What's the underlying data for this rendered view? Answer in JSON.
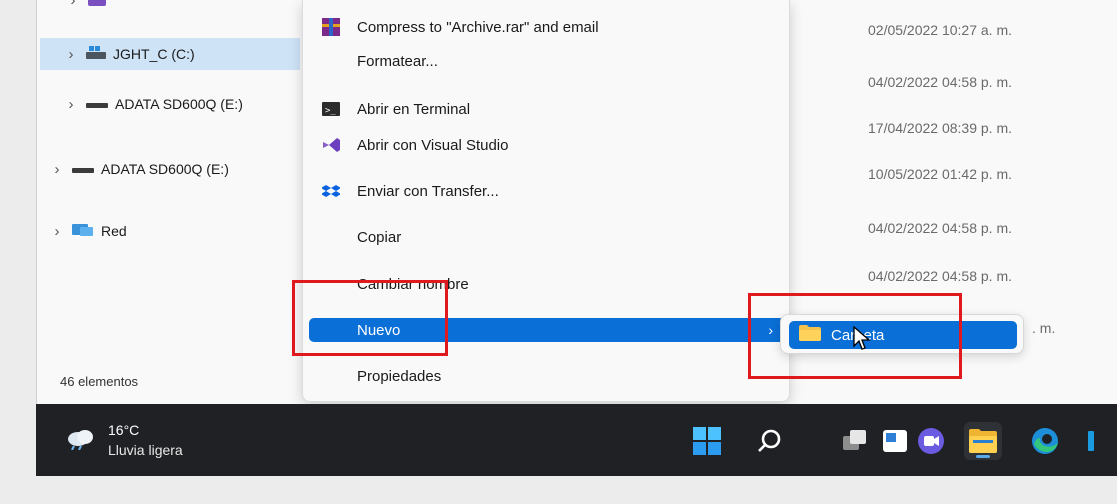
{
  "nav": {
    "items": [
      {
        "label": "JGHT_C (C:)",
        "icon": "drive-windows-icon",
        "selected": true
      },
      {
        "label": "ADATA SD600Q (E:)",
        "icon": "drive-icon",
        "selected": false
      },
      {
        "label": "ADATA SD600Q (E:)",
        "icon": "drive-icon",
        "selected": false
      },
      {
        "label": "Red",
        "icon": "network-icon",
        "selected": false
      }
    ]
  },
  "status": {
    "count_label": "46 elementos"
  },
  "dates": [
    "02/05/2022 10:27 a. m.",
    "04/02/2022 04:58 p. m.",
    "17/04/2022 08:39 p. m.",
    "10/05/2022 01:42 p. m.",
    "04/02/2022 04:58 p. m.",
    "04/02/2022 04:58 p. m.",
    ". m."
  ],
  "context_menu": {
    "items": [
      {
        "label": "Compress to \"Archive.rar\" and email",
        "icon": "winrar-icon"
      },
      {
        "label": "Formatear...",
        "icon": ""
      },
      {
        "label": "Abrir en Terminal",
        "icon": "terminal-icon"
      },
      {
        "label": "Abrir con Visual Studio",
        "icon": "visual-studio-icon"
      },
      {
        "label": "Enviar con Transfer...",
        "icon": "dropbox-icon"
      },
      {
        "label": "Copiar",
        "icon": ""
      },
      {
        "label": "Cambiar nombre",
        "icon": ""
      },
      {
        "label": "Nuevo",
        "icon": "",
        "highlighted": true
      },
      {
        "label": "Propiedades",
        "icon": ""
      }
    ]
  },
  "submenu": {
    "items": [
      {
        "label": "Carpeta",
        "icon": "folder-icon"
      }
    ]
  },
  "taskbar": {
    "weather_temp": "16°C",
    "weather_condition": "Lluvia ligera",
    "apps": [
      "start-icon",
      "search-icon",
      "task-view-icon",
      "widgets-icon",
      "teams-chat-icon",
      "file-explorer-icon",
      "edge-icon"
    ]
  },
  "colors": {
    "accent": "#0a6fd6",
    "highlight_box": "#e0191f",
    "taskbar": "#1f2125"
  }
}
